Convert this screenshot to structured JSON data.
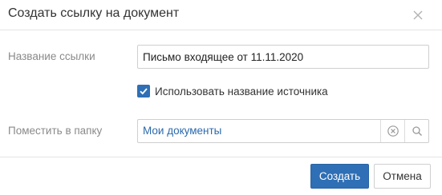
{
  "dialog": {
    "title": "Создать ссылку на документ"
  },
  "form": {
    "link_name_label": "Название ссылки",
    "link_name_value": "Письмо входящее от 11.11.2020",
    "use_source_name_label": "Использовать название источника",
    "use_source_name_checked": true,
    "folder_label": "Поместить в папку",
    "folder_value": "Мои документы"
  },
  "footer": {
    "create_label": "Создать",
    "cancel_label": "Отмена"
  },
  "icons": {
    "close": "close-icon",
    "clear": "clear-circle-icon",
    "search": "search-icon",
    "check": "checkmark-icon"
  },
  "colors": {
    "accent": "#2f6fb5",
    "link": "#2b6aad",
    "label": "#8a8a8a"
  }
}
